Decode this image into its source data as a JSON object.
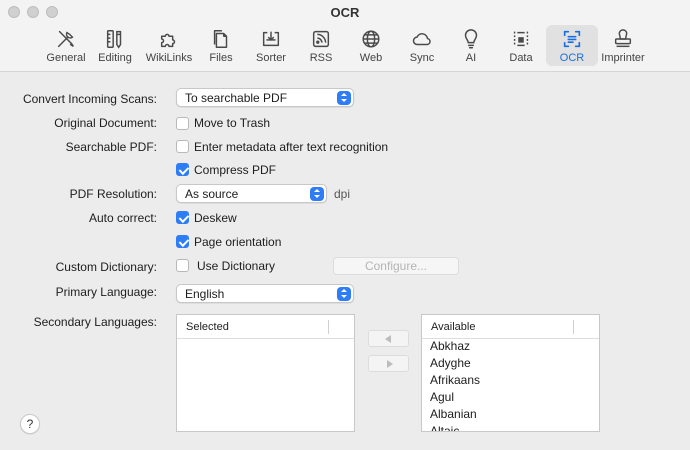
{
  "window": {
    "title": "OCR",
    "traffic_lights": [
      "close",
      "minimize",
      "zoom"
    ]
  },
  "toolbar": {
    "tabs": [
      {
        "label": "General",
        "icon": "wrench-screwdriver-icon"
      },
      {
        "label": "Editing",
        "icon": "pencil-ruler-icon"
      },
      {
        "label": "WikiLinks",
        "icon": "puzzle-icon"
      },
      {
        "label": "Files",
        "icon": "documents-icon"
      },
      {
        "label": "Sorter",
        "icon": "sorter-tray-icon"
      },
      {
        "label": "RSS",
        "icon": "rss-icon"
      },
      {
        "label": "Web",
        "icon": "globe-icon"
      },
      {
        "label": "Sync",
        "icon": "cloud-icon"
      },
      {
        "label": "AI",
        "icon": "lightbulb-icon"
      },
      {
        "label": "Data",
        "icon": "data-frame-icon"
      },
      {
        "label": "OCR",
        "icon": "ocr-scan-icon",
        "active": true
      },
      {
        "label": "Imprinter",
        "icon": "stamp-icon"
      }
    ],
    "accent_color": "#1a6fe0"
  },
  "form": {
    "convert_label": "Convert Incoming Scans:",
    "convert_value": "To searchable PDF",
    "original_label": "Original Document:",
    "move_to_trash": {
      "label": "Move to Trash",
      "checked": false
    },
    "searchable_label": "Searchable PDF:",
    "enter_metadata": {
      "label": "Enter metadata after text recognition",
      "checked": false
    },
    "compress_pdf": {
      "label": "Compress PDF",
      "checked": true
    },
    "resolution_label": "PDF Resolution:",
    "resolution_value": "As source",
    "resolution_unit": "dpi",
    "autocorrect_label": "Auto correct:",
    "deskew": {
      "label": "Deskew",
      "checked": true
    },
    "page_orientation": {
      "label": "Page orientation",
      "checked": true
    },
    "dictionary_label": "Custom Dictionary:",
    "use_dictionary": {
      "label": "Use Dictionary",
      "checked": false
    },
    "configure_label": "Configure...",
    "primary_label": "Primary Language:",
    "primary_value": "English",
    "secondary_label": "Secondary Languages:"
  },
  "selected_list": {
    "header": "Selected",
    "items": []
  },
  "available_list": {
    "header": "Available",
    "items": [
      "Abkhaz",
      "Adyghe",
      "Afrikaans",
      "Agul",
      "Albanian",
      "Altaic"
    ]
  },
  "help_label": "?"
}
